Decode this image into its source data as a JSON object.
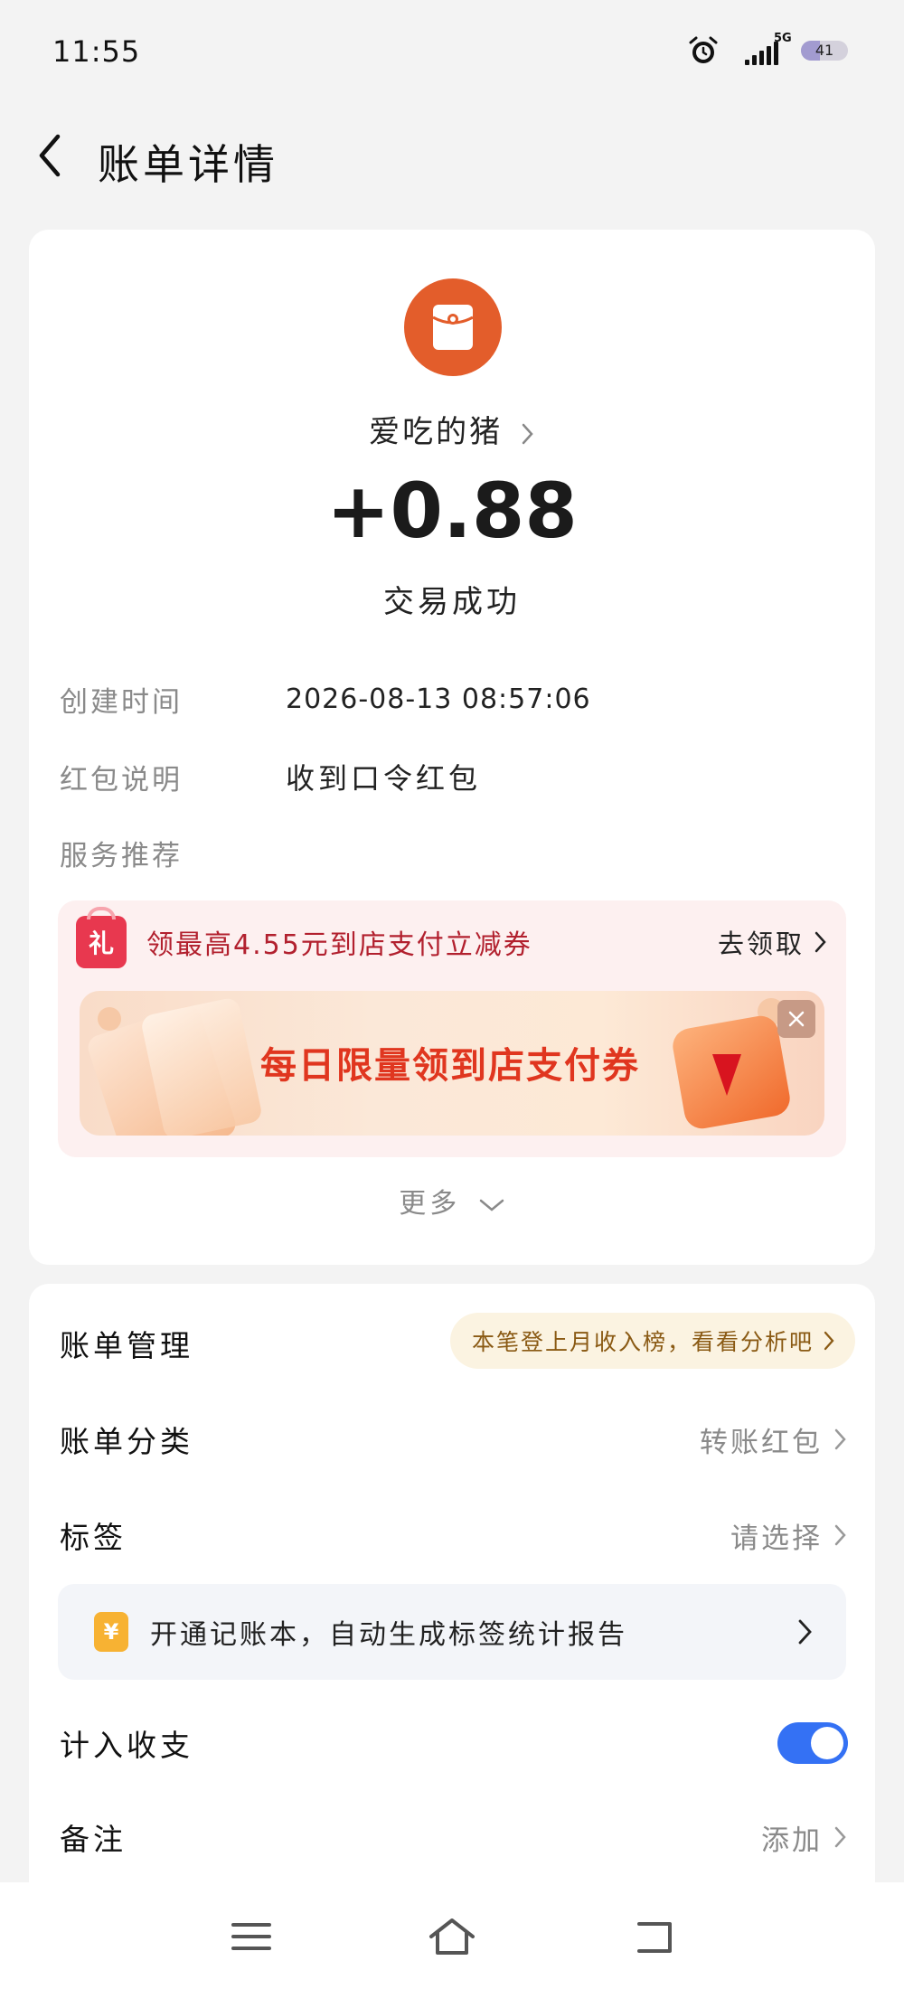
{
  "status_bar": {
    "time": "11:55",
    "network": "5G",
    "battery": "41",
    "battery_level_percent": 41
  },
  "header": {
    "title": "账单详情"
  },
  "transaction": {
    "merchant_name": "爱吃的猪",
    "amount": "+0.88",
    "status": "交易成功"
  },
  "details": [
    {
      "label": "创建时间",
      "value": "2026-08-13 08:57:06"
    },
    {
      "label": "红包说明",
      "value": "收到口令红包"
    },
    {
      "label": "服务推荐",
      "value": ""
    }
  ],
  "promo": {
    "gift_badge": "礼",
    "text": "领最高4.55元到店支付立减券",
    "action": "去领取",
    "banner_text": "每日限量领到店支付券"
  },
  "more": {
    "label": "更多"
  },
  "management": {
    "title": "账单管理",
    "tip": "本笔登上月收入榜，看看分析吧",
    "category_label": "账单分类",
    "category_value": "转账红包",
    "tag_label": "标签",
    "tag_value": "请选择",
    "ledger_icon": "¥",
    "ledger_text": "开通记账本，自动生成标签统计报告",
    "include_label": "计入收支",
    "include_on": true,
    "note_label": "备注",
    "note_value": "添加"
  },
  "colors": {
    "accent": "#3471f4",
    "merchant_avatar": "#e35d2b",
    "promo_text": "#b2202e",
    "banner_text": "#e0361f"
  }
}
